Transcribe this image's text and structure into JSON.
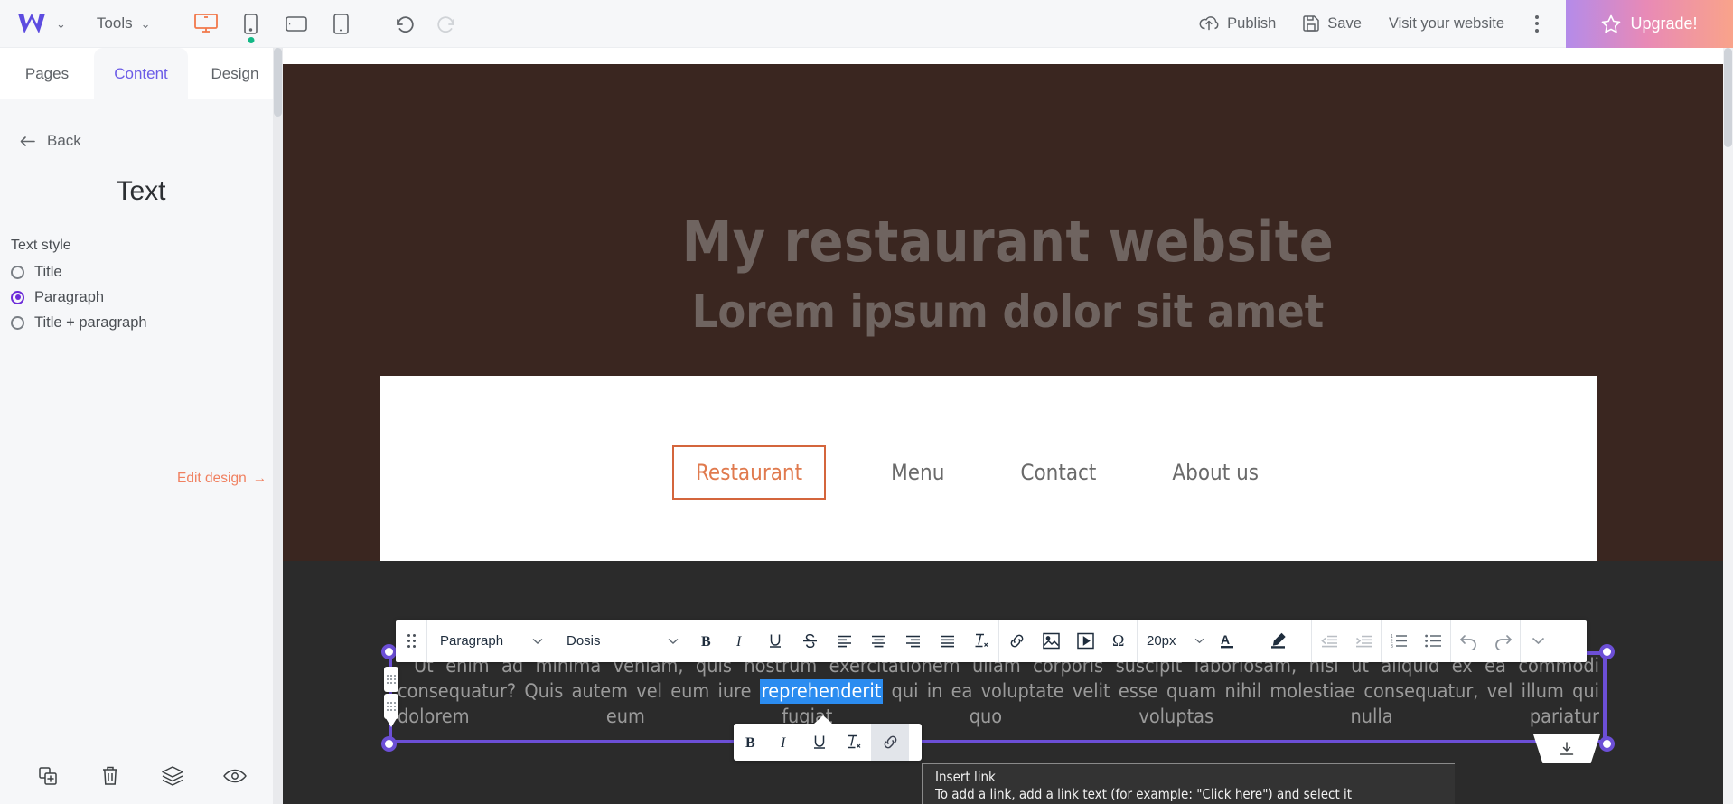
{
  "topbar": {
    "logo_name": "w-logo",
    "brand_chevron": "⌄",
    "tools_label": "Tools",
    "devices": [
      {
        "name": "desktop-view",
        "active": true
      },
      {
        "name": "mobile-view",
        "active": false,
        "badge": true
      },
      {
        "name": "tablet-landscape-view",
        "active": false
      },
      {
        "name": "tablet-view",
        "active": false
      }
    ],
    "undo_label": "undo-icon",
    "redo_label": "redo-icon",
    "publish_label": "Publish",
    "save_label": "Save",
    "visit_label": "Visit your website",
    "upgrade_label": "Upgrade!",
    "accent_orange": "#f2784b",
    "accent_purple": "#6c5ce7"
  },
  "sidebar": {
    "tabs": [
      {
        "label": "Pages",
        "active": false
      },
      {
        "label": "Content",
        "active": true
      },
      {
        "label": "Design",
        "active": false
      }
    ],
    "back_label": "Back",
    "panel_title": "Text",
    "section_label": "Text style",
    "options": [
      {
        "label": "Title",
        "selected": false
      },
      {
        "label": "Paragraph",
        "selected": true
      },
      {
        "label": "Title + paragraph",
        "selected": false
      }
    ],
    "edit_design_label": "Edit design",
    "edit_design_arrow": "→",
    "collapse_glyph": "❮",
    "bottom_tools": [
      "duplicate-icon",
      "delete-icon",
      "layers-icon",
      "preview-icon"
    ]
  },
  "canvas": {
    "hero": {
      "title": "My restaurant website",
      "subtitle": "Lorem ipsum dolor sit amet",
      "background_color": "#3a2620",
      "text_color": "#6f6460"
    },
    "nav": {
      "items": [
        {
          "label": "Restaurant",
          "active": true
        },
        {
          "label": "Menu",
          "active": false
        },
        {
          "label": "Contact",
          "active": false
        },
        {
          "label": "About us",
          "active": false
        }
      ],
      "active_color": "#e07a4e",
      "card_background": "#ffffff"
    },
    "text_block": {
      "line1": "Ut enim ad minima veniam, quis nostrum exercitationem ullam corporis suscipit laboriosam, nisi ut aliquid ex ea commodi",
      "line2_before": "consequatur? Quis autem vel eum iure ",
      "line2_highlight": "reprehenderit",
      "line2_after": " qui in ea voluptate velit esse quam nihil molestiae consequatur, vel illum qui",
      "line3": "dolorem eum fugiat quo voluptas nulla pariatur",
      "selection_color": "#2b8cf0",
      "outline_color": "#6c4fd6"
    }
  },
  "rich_text_toolbar": {
    "drag_handle": "drag-handle-icon",
    "style_value": "Paragraph",
    "font_value": "Dosis",
    "size_value": "20px",
    "chevron": "⌄",
    "buttons": [
      {
        "name": "bold-button",
        "glyph": "B"
      },
      {
        "name": "italic-button",
        "glyph": "I"
      },
      {
        "name": "underline-button",
        "glyph": "U"
      },
      {
        "name": "strikethrough-button",
        "glyph": "S"
      },
      {
        "name": "align-left-button",
        "glyph": "align-left-icon"
      },
      {
        "name": "align-center-button",
        "glyph": "align-center-icon"
      },
      {
        "name": "align-right-button",
        "glyph": "align-right-icon"
      },
      {
        "name": "align-justify-button",
        "glyph": "align-justify-icon"
      },
      {
        "name": "clear-format-button",
        "glyph": "clear-format-icon"
      },
      {
        "name": "insert-link-button",
        "glyph": "link-icon"
      },
      {
        "name": "insert-image-button",
        "glyph": "image-icon"
      },
      {
        "name": "insert-video-button",
        "glyph": "video-icon"
      },
      {
        "name": "special-character-button",
        "glyph": "Ω"
      },
      {
        "name": "text-color-button",
        "glyph": "A"
      },
      {
        "name": "highlight-color-button",
        "glyph": "pen-icon"
      },
      {
        "name": "decrease-indent-button",
        "glyph": "outdent-icon"
      },
      {
        "name": "increase-indent-button",
        "glyph": "indent-icon"
      },
      {
        "name": "ordered-list-button",
        "glyph": "numbered-list-icon"
      },
      {
        "name": "unordered-list-button",
        "glyph": "bullet-list-icon"
      },
      {
        "name": "undo-button",
        "glyph": "undo-icon"
      },
      {
        "name": "redo-button",
        "glyph": "redo-icon"
      },
      {
        "name": "more-options-button",
        "glyph": "chevron-down-icon"
      }
    ]
  },
  "mini_toolbar": {
    "buttons": [
      {
        "name": "bold-button",
        "glyph": "B",
        "selected": false
      },
      {
        "name": "italic-button",
        "glyph": "I",
        "selected": false
      },
      {
        "name": "underline-button",
        "glyph": "U",
        "selected": false
      },
      {
        "name": "clear-format-button",
        "glyph": "clear-format-icon",
        "selected": false
      },
      {
        "name": "insert-link-button",
        "glyph": "link-icon",
        "selected": true
      }
    ]
  },
  "tooltip": {
    "title": "Insert link",
    "body": "To add a link, add a link text (for example: \"Click here\") and select it"
  }
}
